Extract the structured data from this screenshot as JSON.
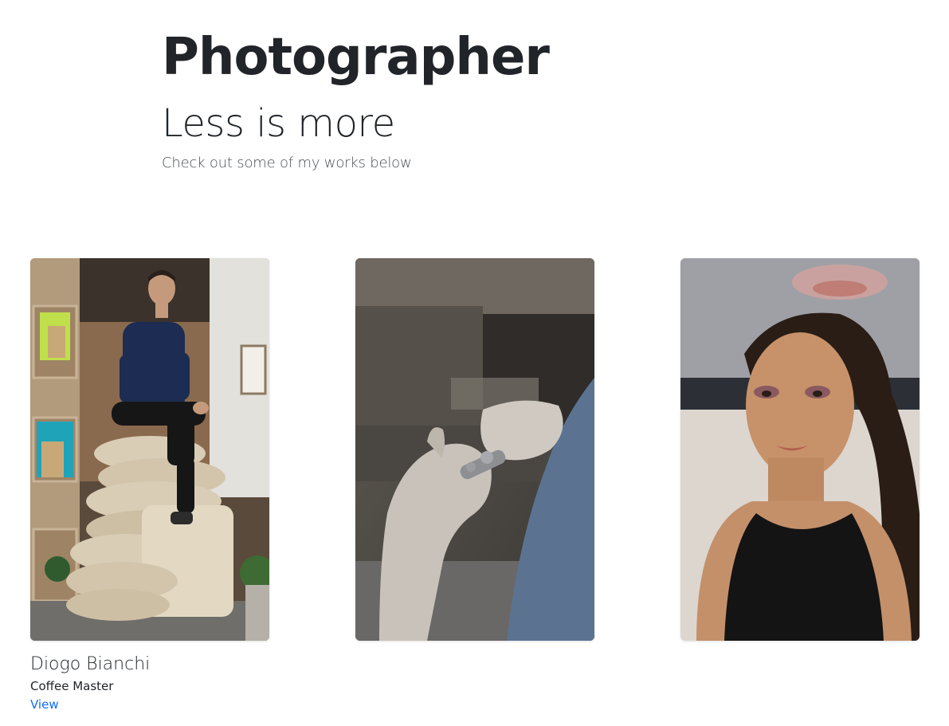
{
  "hero": {
    "title": "Photographer",
    "subtitle": "Less is more",
    "tagline": "Check out some of my works below"
  },
  "cards": [
    {
      "photo_subject": "man sitting on coffee sacks",
      "name": "Diogo Bianchi",
      "role": "Coffee Master",
      "link_label": "View"
    },
    {
      "photo_subject": "hands working with metal tool"
    },
    {
      "photo_subject": "woman portrait with makeup"
    }
  ]
}
